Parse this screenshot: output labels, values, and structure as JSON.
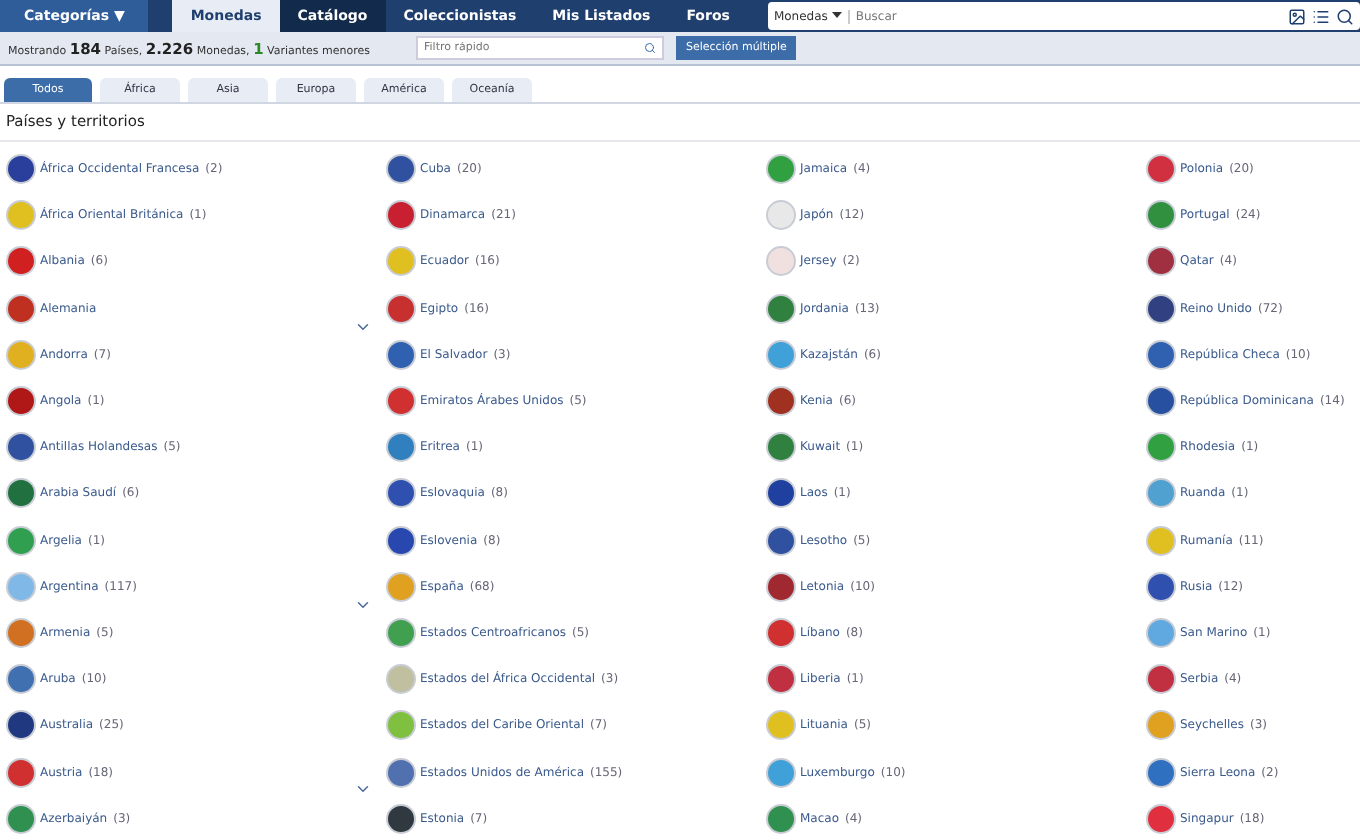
{
  "top_nav": {
    "categories": "Categorías ▼",
    "items": [
      {
        "label": "Monedas",
        "selected": true,
        "kind": "light"
      },
      {
        "label": "Catálogo",
        "selected": true,
        "kind": "dark"
      },
      {
        "label": "Coleccionistas",
        "selected": false,
        "kind": "dark"
      },
      {
        "label": "Mis Listados",
        "selected": false,
        "kind": "dark"
      },
      {
        "label": "Foros",
        "selected": false,
        "kind": "dark"
      }
    ],
    "search": {
      "scope": "Monedas",
      "placeholder": "Buscar"
    }
  },
  "summary": {
    "prefix": "Mostrando",
    "countries": "184",
    "countries_label": "Países,",
    "coins": "2.226",
    "coins_label": "Monedas,",
    "variants": "1",
    "variants_label": "Variantes menores"
  },
  "filter": {
    "placeholder": "Filtro rápido"
  },
  "multi_select": "Selección múltiple",
  "tabs": [
    {
      "label": "Todos",
      "selected": true
    },
    {
      "label": "África",
      "selected": false
    },
    {
      "label": "Asia",
      "selected": false
    },
    {
      "label": "Europa",
      "selected": false
    },
    {
      "label": "América",
      "selected": false
    },
    {
      "label": "Oceanía",
      "selected": false
    }
  ],
  "heading": "Países y territorios",
  "countries": [
    {
      "name": "África Occidental Francesa",
      "count": "(2)",
      "color": "#2a3f9c",
      "expandable": false
    },
    {
      "name": "África Oriental Británica",
      "count": "(1)",
      "color": "#e0c020",
      "expandable": false
    },
    {
      "name": "Albania",
      "count": "(6)",
      "color": "#d02020",
      "expandable": false
    },
    {
      "name": "Alemania",
      "color": "#c03020",
      "expandable": true
    },
    {
      "name": "Andorra",
      "count": "(7)",
      "color": "#e0b020",
      "expandable": false
    },
    {
      "name": "Angola",
      "count": "(1)",
      "color": "#b01818",
      "expandable": false
    },
    {
      "name": "Antillas Holandesas",
      "count": "(5)",
      "color": "#3050a0",
      "expandable": false
    },
    {
      "name": "Arabia Saudí",
      "count": "(6)",
      "color": "#207040",
      "expandable": false
    },
    {
      "name": "Argelia",
      "count": "(1)",
      "color": "#30a050",
      "expandable": false
    },
    {
      "name": "Argentina",
      "count": "(117)",
      "color": "#80b8e8",
      "expandable": true
    },
    {
      "name": "Armenia",
      "count": "(5)",
      "color": "#d07020",
      "expandable": false
    },
    {
      "name": "Aruba",
      "count": "(10)",
      "color": "#4070b0",
      "expandable": false
    },
    {
      "name": "Australia",
      "count": "(25)",
      "color": "#203880",
      "expandable": false
    },
    {
      "name": "Austria",
      "count": "(18)",
      "color": "#d03030",
      "expandable": true
    },
    {
      "name": "Azerbaiyán",
      "count": "(3)",
      "color": "#309050",
      "expandable": false
    },
    {
      "name": "Cuba",
      "count": "(20)",
      "color": "#3050a0",
      "expandable": false
    },
    {
      "name": "Dinamarca",
      "count": "(21)",
      "color": "#c82030",
      "expandable": false
    },
    {
      "name": "Ecuador",
      "count": "(16)",
      "color": "#e0c020",
      "expandable": false
    },
    {
      "name": "Egipto",
      "count": "(16)",
      "color": "#c83030",
      "expandable": false
    },
    {
      "name": "El Salvador",
      "count": "(3)",
      "color": "#3060b0",
      "expandable": false
    },
    {
      "name": "Emiratos Árabes Unidos",
      "count": "(5)",
      "color": "#d03030",
      "expandable": false
    },
    {
      "name": "Eritrea",
      "count": "(1)",
      "color": "#3080c0",
      "expandable": false
    },
    {
      "name": "Eslovaquia",
      "count": "(8)",
      "color": "#3050b0",
      "expandable": false
    },
    {
      "name": "Eslovenia",
      "count": "(8)",
      "color": "#2848b0",
      "expandable": false
    },
    {
      "name": "España",
      "count": "(68)",
      "color": "#e0a020",
      "expandable": false
    },
    {
      "name": "Estados Centroafricanos",
      "count": "(5)",
      "color": "#40a050",
      "expandable": false
    },
    {
      "name": "Estados del África Occidental",
      "count": "(3)",
      "color": "#c0c0a0",
      "expandable": false
    },
    {
      "name": "Estados del Caribe Oriental",
      "count": "(7)",
      "color": "#80c040",
      "expandable": false
    },
    {
      "name": "Estados Unidos de América",
      "count": "(155)",
      "color": "#5070b0",
      "expandable": false
    },
    {
      "name": "Estonia",
      "count": "(7)",
      "color": "#303840",
      "expandable": false
    },
    {
      "name": "Jamaica",
      "count": "(4)",
      "color": "#30a040",
      "expandable": false
    },
    {
      "name": "Japón",
      "count": "(12)",
      "color": "#e8e8e8",
      "expandable": false
    },
    {
      "name": "Jersey",
      "count": "(2)",
      "color": "#f0e0e0",
      "expandable": false
    },
    {
      "name": "Jordania",
      "count": "(13)",
      "color": "#308040",
      "expandable": false
    },
    {
      "name": "Kazajstán",
      "count": "(6)",
      "color": "#40a0d8",
      "expandable": false
    },
    {
      "name": "Kenia",
      "count": "(6)",
      "color": "#a03020",
      "expandable": false
    },
    {
      "name": "Kuwait",
      "count": "(1)",
      "color": "#308040",
      "expandable": false
    },
    {
      "name": "Laos",
      "count": "(1)",
      "color": "#2040a0",
      "expandable": false
    },
    {
      "name": "Lesotho",
      "count": "(5)",
      "color": "#3050a0",
      "expandable": false
    },
    {
      "name": "Letonia",
      "count": "(10)",
      "color": "#a02830",
      "expandable": false
    },
    {
      "name": "Líbano",
      "count": "(8)",
      "color": "#d03030",
      "expandable": false
    },
    {
      "name": "Liberia",
      "count": "(1)",
      "color": "#c03040",
      "expandable": false
    },
    {
      "name": "Lituania",
      "count": "(5)",
      "color": "#e0c020",
      "expandable": false
    },
    {
      "name": "Luxemburgo",
      "count": "(10)",
      "color": "#40a0d8",
      "expandable": false
    },
    {
      "name": "Macao",
      "count": "(4)",
      "color": "#309050",
      "expandable": false
    },
    {
      "name": "Polonia",
      "count": "(20)",
      "color": "#d03040",
      "expandable": false
    },
    {
      "name": "Portugal",
      "count": "(24)",
      "color": "#309040",
      "expandable": false
    },
    {
      "name": "Qatar",
      "count": "(4)",
      "color": "#a03040",
      "expandable": false
    },
    {
      "name": "Reino Unido",
      "count": "(72)",
      "color": "#304080",
      "expandable": false
    },
    {
      "name": "República Checa",
      "count": "(10)",
      "color": "#3060b0",
      "expandable": false
    },
    {
      "name": "República Dominicana",
      "count": "(14)",
      "color": "#2850a0",
      "expandable": false
    },
    {
      "name": "Rhodesia",
      "count": "(1)",
      "color": "#30a040",
      "expandable": false
    },
    {
      "name": "Ruanda",
      "count": "(1)",
      "color": "#50a0d0",
      "expandable": false
    },
    {
      "name": "Rumanía",
      "count": "(11)",
      "color": "#e0c020",
      "expandable": false
    },
    {
      "name": "Rusia",
      "count": "(12)",
      "color": "#3050b0",
      "expandable": false
    },
    {
      "name": "San Marino",
      "count": "(1)",
      "color": "#60a8e0",
      "expandable": false
    },
    {
      "name": "Serbia",
      "count": "(4)",
      "color": "#c03040",
      "expandable": false
    },
    {
      "name": "Seychelles",
      "count": "(3)",
      "color": "#e0a020",
      "expandable": false
    },
    {
      "name": "Sierra Leona",
      "count": "(2)",
      "color": "#3070c0",
      "expandable": false
    },
    {
      "name": "Singapur",
      "count": "(18)",
      "color": "#e03040",
      "expandable": false
    }
  ]
}
